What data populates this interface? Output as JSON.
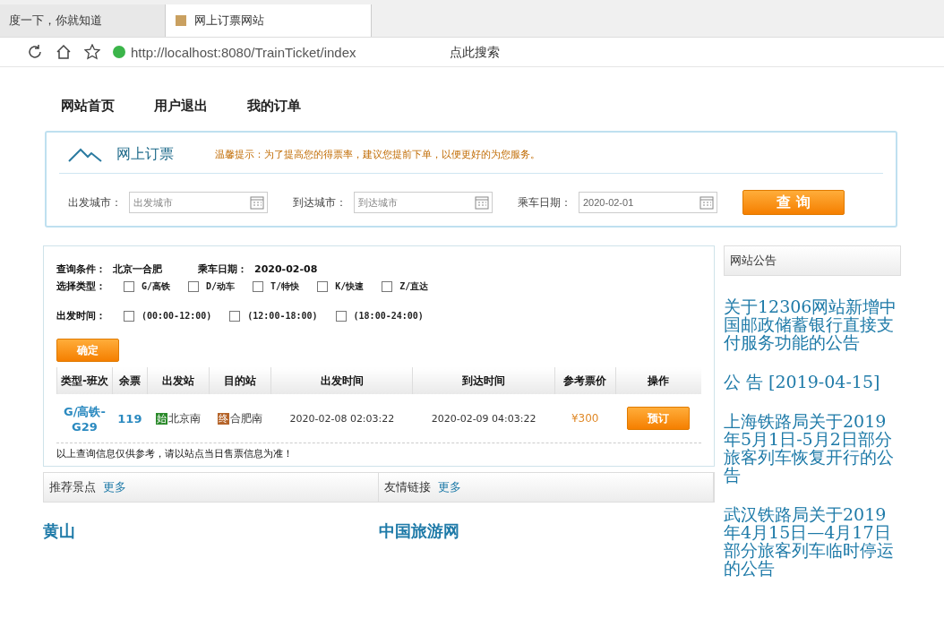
{
  "browser": {
    "tabs": [
      {
        "title": "度一下，你就知道",
        "selected": false
      },
      {
        "title": "网上订票网站",
        "selected": true
      }
    ],
    "address": "http://localhost:8080/TrainTicket/index",
    "search_placeholder": "点此搜索"
  },
  "nav": [
    "网站首页",
    "用户退出",
    "我的订单"
  ],
  "booking": {
    "title": "网上订票",
    "tip": "温馨提示：为了提高您的得票率，建议您提前下单，以便更好的为您服务。",
    "fields": [
      {
        "label": "出发城市：",
        "placeholder": "出发城市"
      },
      {
        "label": "到达城市：",
        "placeholder": "到达城市"
      },
      {
        "label": "乘车日期：",
        "value": "2020-02-01"
      }
    ],
    "search_button": "查 询"
  },
  "results": {
    "condition_label": "查询条件：",
    "condition": "北京一合肥",
    "date_label": "乘车日期：",
    "date": "2020-02-08",
    "type_label": "选择类型：",
    "types": [
      {
        "label": "G/高铁",
        "checked": false
      },
      {
        "label": "D/动车",
        "checked": false
      },
      {
        "label": "T/特快",
        "checked": false
      },
      {
        "label": "K/快速",
        "checked": false
      },
      {
        "label": "Z/直达",
        "checked": false
      }
    ],
    "time_label": "出发时间：",
    "times": [
      {
        "label": "(00:00-12:00)",
        "checked": false
      },
      {
        "label": "(12:00-18:00)",
        "checked": false
      },
      {
        "label": "(18:00-24:00)",
        "checked": false
      }
    ],
    "confirm_button": "确定",
    "columns": [
      "类型-班次",
      "余票",
      "出发站",
      "目的站",
      "出发时间",
      "到达时间",
      "参考票价",
      "操作"
    ],
    "rows": [
      {
        "train": "G/高铁-G29",
        "remaining": "119",
        "from_badge": "始",
        "from": "北京南",
        "to_badge": "终",
        "to": "合肥南",
        "depart": "2020-02-08 02:03:22",
        "arrive": "2020-02-09 04:03:22",
        "price": "¥300",
        "action": "预订"
      }
    ],
    "note": "以上查询信息仅供参考，请以站点当日售票信息为准！"
  },
  "attractions": {
    "title": "推荐景点",
    "more": "更多",
    "items": [
      "黄山"
    ]
  },
  "links": {
    "title": "友情链接",
    "more": "更多",
    "items": [
      "中国旅游网"
    ]
  },
  "notices": {
    "title": "网站公告",
    "items": [
      "关于12306网站新增中国邮政储蓄银行直接支付服务功能的公告",
      "公 告 [2019-04-15]",
      "上海铁路局关于2019年5月1日-5月2日部分旅客列车恢复开行的公告",
      "武汉铁路局关于2019年4月15日—4月17日部分旅客列车临时停运的公告"
    ]
  }
}
